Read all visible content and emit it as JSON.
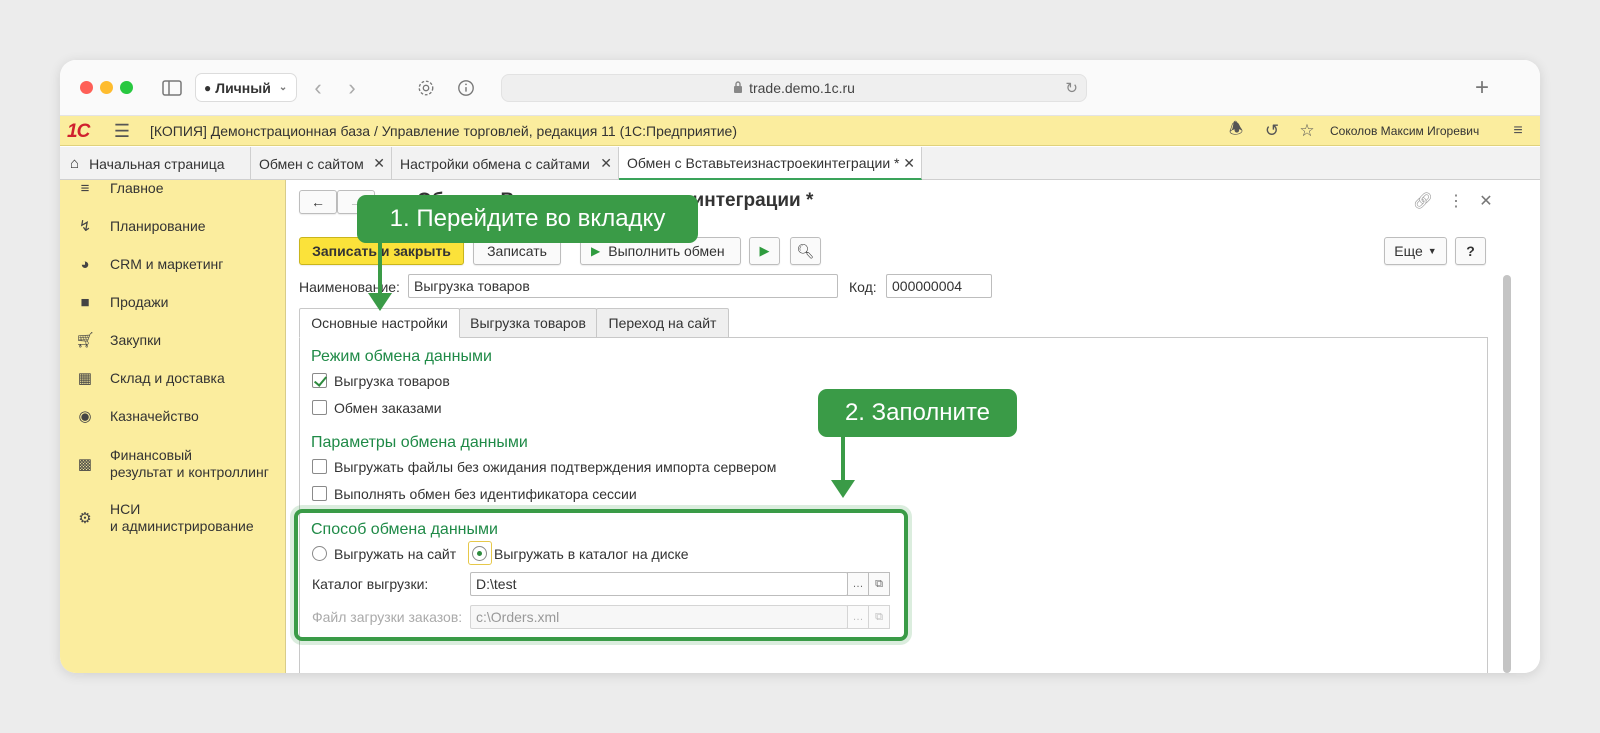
{
  "browser": {
    "profile_label": "Личный",
    "url": "trade.demo.1c.ru",
    "new_tab": "+"
  },
  "app": {
    "logo": "1С",
    "title": "[КОПИЯ] Демонстрационная база / Управление торговлей, редакция 11  (1С:Предприятие)",
    "user": "Соколов Максим Игоревич"
  },
  "tabs": [
    {
      "label": "Начальная страница"
    },
    {
      "label": "Обмен с сайтом"
    },
    {
      "label": "Настройки обмена с сайтами"
    },
    {
      "label": "Обмен с Вставьтеизнастроекинтеграции *"
    }
  ],
  "sidebar": {
    "items": [
      {
        "label": "Главное",
        "icon": "menu-icon"
      },
      {
        "label": "Планирование",
        "icon": "planning-icon"
      },
      {
        "label": "CRM и маркетинг",
        "icon": "pie-icon"
      },
      {
        "label": "Продажи",
        "icon": "bag-icon"
      },
      {
        "label": "Закупки",
        "icon": "cart-icon"
      },
      {
        "label": "Склад и доставка",
        "icon": "grid-icon"
      },
      {
        "label": "Казначейство",
        "icon": "ruble-icon"
      },
      {
        "label": "Финансовый",
        "label2": "результат и контроллинг",
        "icon": "chart-icon"
      },
      {
        "label": "НСИ",
        "label2": "и администрирование",
        "icon": "gear-icon"
      }
    ]
  },
  "form": {
    "title": "Обмен с Вставьтеизнастроекинтеграции *",
    "buttons": {
      "save_close": "Записать и закрыть",
      "save": "Записать",
      "run": "Выполнить обмен",
      "more": "Еще",
      "help": "?"
    },
    "name_label": "Наименование:",
    "name_value": "Выгрузка товаров",
    "code_label": "Код:",
    "code_value": "000000004",
    "tabs": [
      "Основные настройки",
      "Выгрузка товаров",
      "Переход на сайт"
    ],
    "section_mode": "Режим обмена данными",
    "chk_goods": "Выгрузка товаров",
    "chk_orders": "Обмен заказами",
    "section_params": "Параметры обмена данными",
    "chk_no_wait": "Выгружать файлы без ожидания подтверждения импорта сервером",
    "chk_no_session": "Выполнять обмен без идентификатора сессии",
    "section_method": "Способ обмена данными",
    "radio_site": "Выгружать на сайт",
    "radio_disk": "Выгружать в каталог на диске",
    "dir_label": "Каталог выгрузки:",
    "dir_value": "D:\\test",
    "orders_file_label": "Файл загрузки заказов:",
    "orders_file_value": "c:\\Orders.xml"
  },
  "callouts": {
    "step1": "1. Перейдите во вкладку",
    "step2": "2. Заполните"
  },
  "colors": {
    "accent_green": "#3a9b47",
    "header_yellow": "#fbed9e",
    "primary_button": "#fbe23a"
  }
}
